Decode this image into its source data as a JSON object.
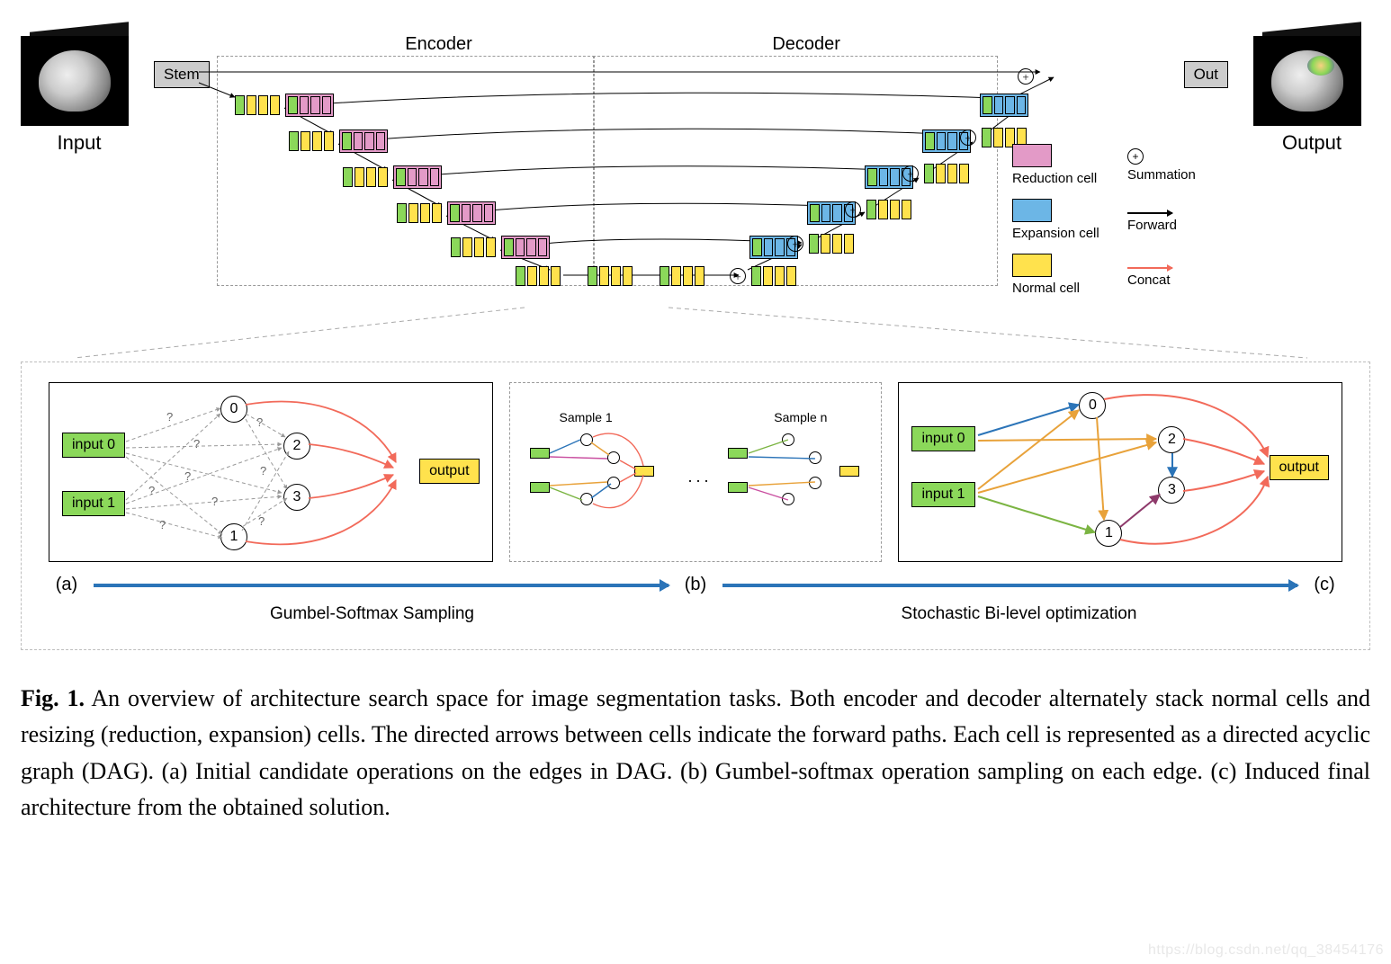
{
  "io": {
    "input_label": "Input",
    "output_label": "Output"
  },
  "blocks": {
    "stem": "Stem",
    "out": "Out",
    "encoder_label": "Encoder",
    "decoder_label": "Decoder"
  },
  "legend": {
    "reduction": "Reduction cell",
    "expansion": "Expansion cell",
    "normal": "Normal cell",
    "summation": "Summation",
    "forward": "Forward",
    "concat": "Concat",
    "plus": "+"
  },
  "dag": {
    "input0": "input 0",
    "input1": "input 1",
    "output": "output",
    "n0": "0",
    "n1": "1",
    "n2": "2",
    "n3": "3",
    "q": "?",
    "sample1": "Sample 1",
    "samplen": "Sample n",
    "ellipsis": ". . ."
  },
  "sub": {
    "a": "(a)",
    "b": "(b)",
    "c": "(c)",
    "gumbel": "Gumbel-Softmax Sampling",
    "bilevel": "Stochastic Bi-level optimization"
  },
  "caption": {
    "lead": "Fig. 1.",
    "text": " An overview of architecture search space for image segmentation tasks. Both encoder and decoder alternately stack normal cells and resizing (reduction, expansion) cells. The directed arrows between cells indicate the forward paths. Each cell is represented as a directed acyclic graph (DAG). (a) Initial candidate operations on the edges in DAG. (b) Gumbel-softmax operation sampling on each edge. (c) Induced final architecture from the obtained solution."
  },
  "watermark": "https://blog.csdn.net/qq_38454176",
  "chart_data": {
    "type": "diagram",
    "title": "Architecture search space for image segmentation (encoder-decoder with searchable cells)",
    "top_level": {
      "encoder": {
        "depth_levels": 6,
        "pattern_per_level": [
          "normal",
          "reduction"
        ],
        "skip_connections": "forward arrows from each encoder level to matching decoder level and to Out"
      },
      "decoder": {
        "depth_levels": 6,
        "pattern_per_level": [
          "normal",
          "expansion"
        ],
        "merge_op": "summation (⊕) node before each expansion cell"
      },
      "stem": "input stem block before encoder",
      "out": "output head after decoder"
    },
    "cell_types": [
      {
        "name": "Reduction cell",
        "color": "#e39ac7"
      },
      {
        "name": "Expansion cell",
        "color": "#6cb6e6"
      },
      {
        "name": "Normal cell",
        "color": "#ffe24d"
      }
    ],
    "edge_types": [
      {
        "name": "Forward",
        "arrow": "black"
      },
      {
        "name": "Concat",
        "arrow": "red"
      },
      {
        "name": "Summation",
        "symbol": "⊕"
      }
    ],
    "cell_internal_dag": {
      "inputs": [
        "input 0",
        "input 1"
      ],
      "intermediate_nodes": [
        "0",
        "1",
        "2",
        "3"
      ],
      "output": "output",
      "panel_a": "every pair (input_i, node_j) and (node_j, node_k<j) connected by candidate-operation edge labelled '?'; all intermediate nodes concat (red) into output",
      "panel_b": "n Gumbel-Softmax samples of panel (a) — each sample keeps one coloured op per edge",
      "panel_c": "final induced architecture — one chosen operation per retained edge; nodes 0–3 concat into output"
    },
    "pipeline_arrows": [
      {
        "from": "(a)",
        "to": "(b)",
        "label": "Gumbel-Softmax Sampling"
      },
      {
        "from": "(b)",
        "to": "(c)",
        "label": "Stochastic Bi-level optimization"
      }
    ]
  }
}
